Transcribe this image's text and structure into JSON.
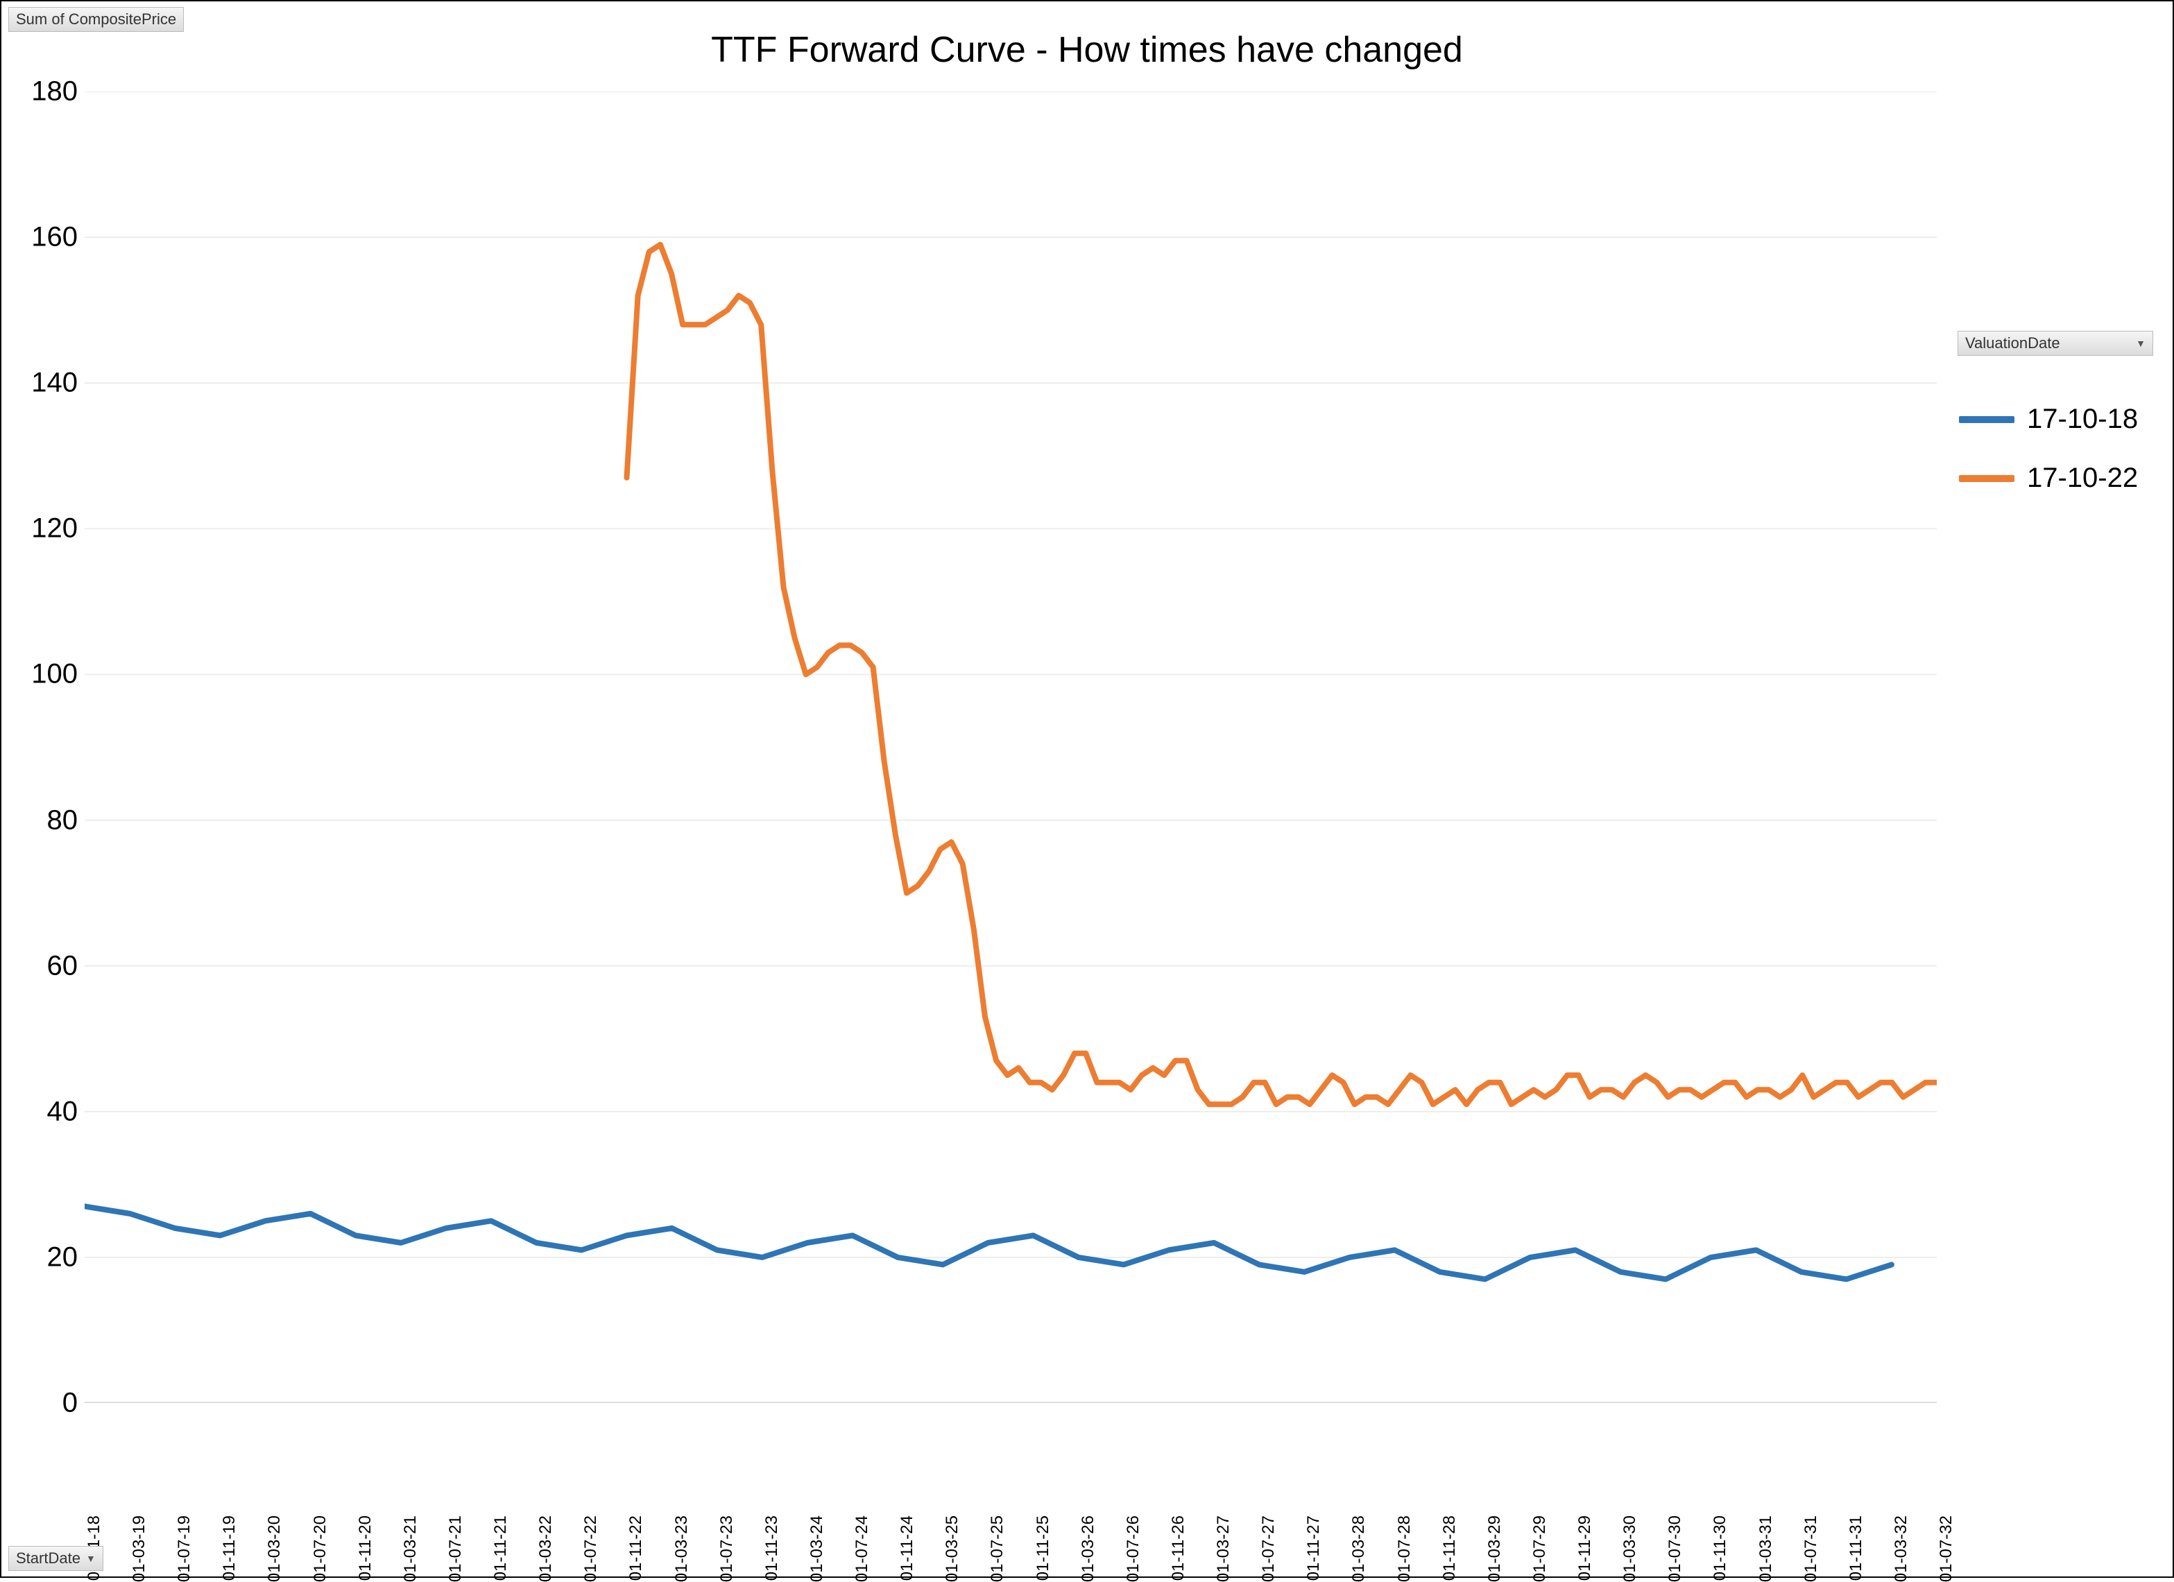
{
  "buttons": {
    "y_field": "Sum of CompositePrice",
    "x_field": "StartDate",
    "legend_field": "ValuationDate"
  },
  "legend": {
    "s1": "17-10-18",
    "s2": "17-10-22"
  },
  "colors": {
    "s1": "#2e75b6",
    "s2": "#ed7d31"
  },
  "chart_data": {
    "type": "line",
    "title": "TTF Forward Curve - How times have changed",
    "xlabel": "",
    "ylabel": "",
    "ylim": [
      0,
      180
    ],
    "y_ticks": [
      0,
      20,
      40,
      60,
      80,
      100,
      120,
      140,
      160,
      180
    ],
    "categories": [
      "01-11-18",
      "01-03-19",
      "01-07-19",
      "01-11-19",
      "01-03-20",
      "01-07-20",
      "01-11-20",
      "01-03-21",
      "01-07-21",
      "01-11-21",
      "01-03-22",
      "01-07-22",
      "01-11-22",
      "01-03-23",
      "01-07-23",
      "01-11-23",
      "01-03-24",
      "01-07-24",
      "01-11-24",
      "01-03-25",
      "01-07-25",
      "01-11-25",
      "01-03-26",
      "01-07-26",
      "01-11-26",
      "01-03-27",
      "01-07-27",
      "01-11-27",
      "01-03-28",
      "01-07-28",
      "01-11-28",
      "01-03-29",
      "01-07-29",
      "01-11-29",
      "01-03-30",
      "01-07-30",
      "01-11-30",
      "01-03-31",
      "01-07-31",
      "01-11-31",
      "01-03-32",
      "01-07-32"
    ],
    "series": [
      {
        "name": "17-10-18",
        "color": "#2e75b6",
        "start_index": 0,
        "values": [
          27,
          26,
          24,
          23,
          25,
          26,
          23,
          22,
          24,
          25,
          22,
          21,
          23,
          24,
          21,
          20,
          22,
          23,
          20,
          19,
          22,
          23,
          20,
          19,
          21,
          22,
          19,
          18,
          20,
          21,
          18,
          17,
          20,
          21,
          18,
          17,
          20,
          21,
          18,
          17,
          19
        ]
      },
      {
        "name": "17-10-22",
        "color": "#ed7d31",
        "start_index": 24,
        "values": [
          127,
          152,
          158,
          159,
          155,
          148,
          148,
          148,
          149,
          150,
          152,
          151,
          148,
          128,
          112,
          105,
          100,
          101,
          103,
          104,
          104,
          103,
          101,
          88,
          78,
          70,
          71,
          73,
          76,
          77,
          74,
          65,
          53,
          47,
          45,
          46,
          44,
          44,
          43,
          45,
          48,
          48,
          44,
          44,
          44,
          43,
          45,
          46,
          45,
          47,
          47,
          43,
          41,
          41,
          41,
          42,
          44,
          44,
          41,
          42,
          42,
          41,
          43,
          45,
          44,
          41,
          42,
          42,
          41,
          43,
          45,
          44,
          41,
          42,
          43,
          41,
          43,
          44,
          44,
          41,
          42,
          43,
          42,
          43,
          45,
          45,
          42,
          43,
          43,
          42,
          44,
          45,
          44,
          42,
          43,
          43,
          42,
          43,
          44,
          44,
          42,
          43,
          43,
          42,
          43,
          45,
          42,
          43,
          44,
          44,
          42,
          43,
          44,
          44,
          42,
          43,
          44,
          44
        ]
      }
    ]
  }
}
